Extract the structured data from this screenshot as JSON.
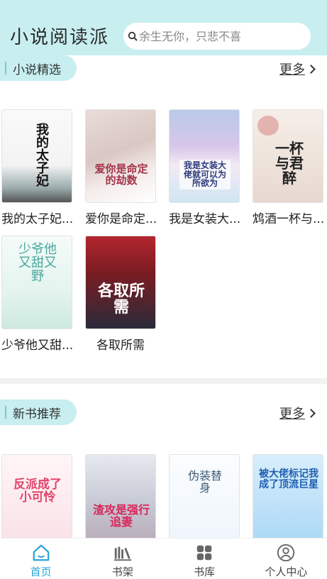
{
  "header": {
    "title": "小说阅读派",
    "search_placeholder": "余生无你，只悲不喜"
  },
  "sections": [
    {
      "title": "小说精选",
      "more": "更多",
      "books": [
        {
          "title": "我的太子妃...",
          "cover_text": "我的太子妃"
        },
        {
          "title": "爱你是命定...",
          "cover_text": "爱你是命定的劫数"
        },
        {
          "title": "我是女装大...",
          "cover_text": "我是女装大佬就可以为所欲为"
        },
        {
          "title": "鸩酒一杯与...",
          "cover_text": "一杯与君醉"
        },
        {
          "title": "少爷他又甜...",
          "cover_text": "少爷他又甜又野"
        },
        {
          "title": "各取所需",
          "cover_text": "各取所需"
        }
      ]
    },
    {
      "title": "新书推荐",
      "more": "更多",
      "books": [
        {
          "cover_text": "反派成了小可怜"
        },
        {
          "cover_text": "渣攻是强行追妻"
        },
        {
          "cover_text": "伪装替身"
        },
        {
          "cover_text": "被大佬标记我成了顶流巨星"
        }
      ]
    }
  ],
  "tabbar": {
    "tabs": [
      {
        "label": "首页",
        "icon": "home-icon",
        "active": true
      },
      {
        "label": "书架",
        "icon": "bookshelf-icon",
        "active": false
      },
      {
        "label": "书库",
        "icon": "grid-icon",
        "active": false
      },
      {
        "label": "个人中心",
        "icon": "user-icon",
        "active": false
      }
    ],
    "active_color": "#2aa5d8"
  },
  "colors": {
    "accent_bg": "#c8eef0"
  }
}
